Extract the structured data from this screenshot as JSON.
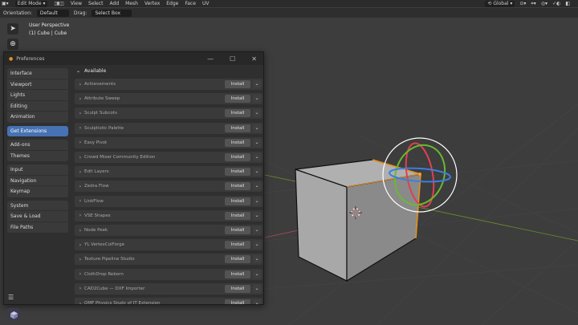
{
  "topbar": {
    "mode": "Edit Mode",
    "menus": [
      "View",
      "Select",
      "Add",
      "Mesh",
      "Vertex",
      "Edge",
      "Face",
      "UV"
    ],
    "orientation": "Global"
  },
  "tool_options": {
    "orientation_label": "Orientation:",
    "orientation_value": "Default",
    "drag_label": "Drag:",
    "drag_value": "Select Box"
  },
  "viewport": {
    "view_name": "User Perspective",
    "object_info": "(1) Cube | Cube"
  },
  "prefs": {
    "title": "Preferences",
    "nav_groups": [
      [
        {
          "label": "Interface"
        },
        {
          "label": "Viewport"
        },
        {
          "label": "Lights"
        },
        {
          "label": "Editing"
        },
        {
          "label": "Animation"
        }
      ],
      [
        {
          "label": "Get Extensions",
          "active": true
        }
      ],
      [
        {
          "label": "Add-ons"
        },
        {
          "label": "Themes"
        }
      ],
      [
        {
          "label": "Input"
        },
        {
          "label": "Navigation"
        },
        {
          "label": "Keymap"
        }
      ],
      [
        {
          "label": "System"
        },
        {
          "label": "Save & Load"
        },
        {
          "label": "File Paths"
        }
      ]
    ],
    "section_label": "Available",
    "install_label": "Install",
    "extensions": [
      "Achievements",
      "Attribute Sweep",
      "Sculpt Subcots",
      "Sculptistic Palette",
      "Easy Pivot",
      "Crowd Mixer Community Edition",
      "Edit Layers",
      "Zedra Flow",
      "LinkFlow",
      "VSE Shapes",
      "Node Peek",
      "YL VertexColForge",
      "Texture Pipeline Studio",
      "ClothDrop Reborn",
      "CAD2Cube — DXF Importer",
      "QMF Physics Study of IT Extension"
    ]
  },
  "colors": {
    "accent": "#4772b3",
    "selection_orange": "#e8901e",
    "gizmo_x": "#e04050",
    "gizmo_y": "#6ab832",
    "gizmo_z": "#3a7fe0"
  }
}
